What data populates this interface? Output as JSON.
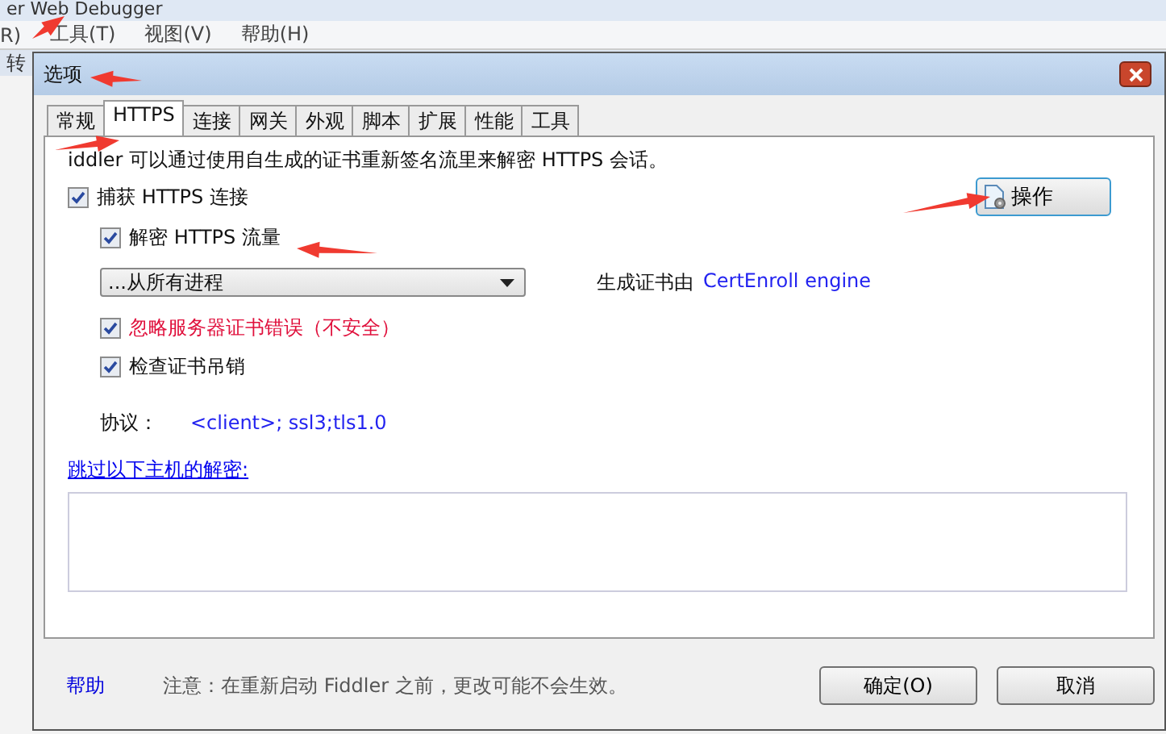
{
  "app": {
    "title": "er Web Debugger",
    "menu": [
      "R)",
      "工具(T)",
      "视图(V)",
      "帮助(H)"
    ],
    "toolbar_fragment": "转"
  },
  "dialog": {
    "title": "选项",
    "tabs": [
      {
        "label": "常规",
        "selected": false
      },
      {
        "label": "HTTPS",
        "selected": true
      },
      {
        "label": "连接",
        "selected": false
      },
      {
        "label": "网关",
        "selected": false
      },
      {
        "label": "外观",
        "selected": false
      },
      {
        "label": "脚本",
        "selected": false
      },
      {
        "label": "扩展",
        "selected": false
      },
      {
        "label": "性能",
        "selected": false
      },
      {
        "label": "工具",
        "selected": false
      }
    ],
    "intro": "iddler 可以通过使用自生成的证书重新签名流里来解密 HTTPS 会话。",
    "capture_https": {
      "label": "捕获 HTTPS 连接",
      "checked": true
    },
    "actions_button": "操作",
    "decrypt_https": {
      "label": "解密 HTTPS 流量",
      "checked": true
    },
    "process_filter": {
      "value": "...从所有进程"
    },
    "cert_generator": {
      "label": "生成证书由",
      "value": "CertEnroll engine"
    },
    "ignore_errors": {
      "label": "忽略服务器证书错误（不安全）",
      "checked": true
    },
    "check_revocation": {
      "label": "检查证书吊销",
      "checked": true
    },
    "protocols": {
      "label": "协议：",
      "value": "<client>; ssl3;tls1.0"
    },
    "skip_link": "跳过以下主机的解密:",
    "footer": {
      "help_link": "帮助",
      "note": "注意：在重新启动 Fiddler 之前，更改可能不会生效。",
      "buttons": [
        "确定(O)",
        "取消"
      ]
    }
  }
}
